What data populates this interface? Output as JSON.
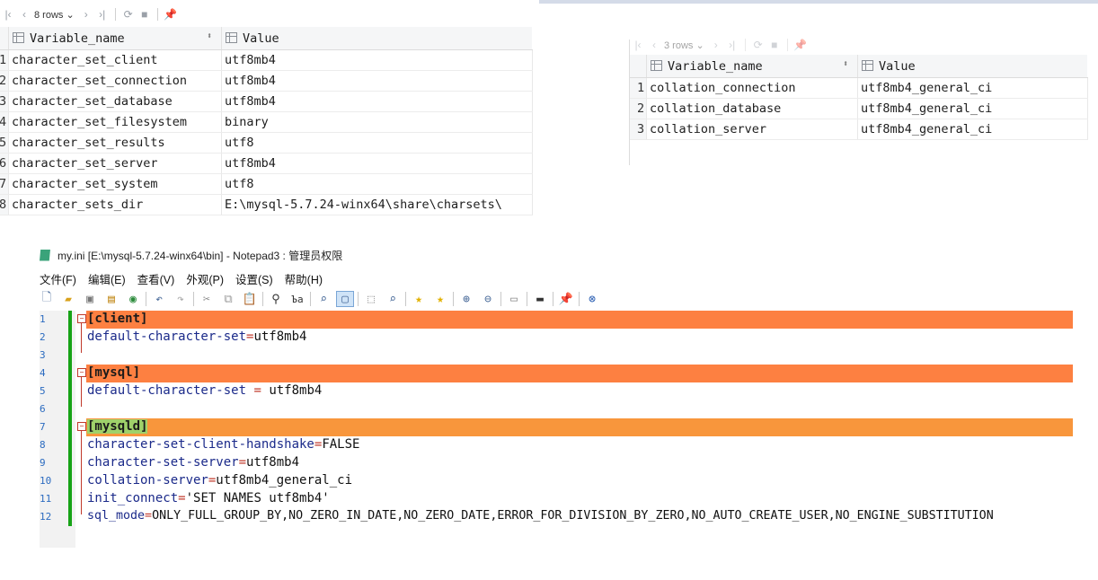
{
  "grid1": {
    "rows_label": "8 rows",
    "columns": [
      "Variable_name",
      "Value"
    ],
    "rows": [
      {
        "n": "1",
        "name": "character_set_client",
        "value": "utf8mb4"
      },
      {
        "n": "2",
        "name": "character_set_connection",
        "value": "utf8mb4"
      },
      {
        "n": "3",
        "name": "character_set_database",
        "value": "utf8mb4"
      },
      {
        "n": "4",
        "name": "character_set_filesystem",
        "value": "binary"
      },
      {
        "n": "5",
        "name": "character_set_results",
        "value": "utf8"
      },
      {
        "n": "6",
        "name": "character_set_server",
        "value": "utf8mb4"
      },
      {
        "n": "7",
        "name": "character_set_system",
        "value": "utf8"
      },
      {
        "n": "8",
        "name": "character_sets_dir",
        "value": "E:\\mysql-5.7.24-winx64\\share\\charsets\\"
      }
    ]
  },
  "grid2": {
    "rows_label": "3 rows",
    "columns": [
      "Variable_name",
      "Value"
    ],
    "rows": [
      {
        "n": "1",
        "name": "collation_connection",
        "value": "utf8mb4_general_ci"
      },
      {
        "n": "2",
        "name": "collation_database",
        "value": "utf8mb4_general_ci"
      },
      {
        "n": "3",
        "name": "collation_server",
        "value": "utf8mb4_general_ci"
      }
    ]
  },
  "notepad": {
    "title": "my.ini [E:\\mysql-5.7.24-winx64\\bin] - Notepad3 : 管理员权限",
    "menu": [
      "文件(F)",
      "编辑(E)",
      "查看(V)",
      "外观(P)",
      "设置(S)",
      "帮助(H)"
    ],
    "lines": {
      "l1": "[client]",
      "l2_key": "default-character-set",
      "l2_op": "=",
      "l2_val": "utf8mb4",
      "l4": "[mysql]",
      "l5_key": "default-character-set",
      "l5_op": " = ",
      "l5_val": "utf8mb4",
      "l7": "[mysqld]",
      "l8_key": "character-set-client-handshake",
      "l8_op": "=",
      "l8_val": "FALSE",
      "l9_key": "character-set-server",
      "l9_op": "=",
      "l9_val": "utf8mb4",
      "l10_key": "collation-server",
      "l10_op": "=",
      "l10_val": "utf8mb4_general_ci",
      "l11_key": "init_connect",
      "l11_op": "=",
      "l11_val": "'SET NAMES utf8mb4'",
      "l12_key": "sql_mode",
      "l12_op": "=",
      "l12_val": "ONLY_FULL_GROUP_BY,NO_ZERO_IN_DATE,NO_ZERO_DATE,ERROR_FOR_DIVISION_BY_ZERO,NO_AUTO_CREATE_USER,NO_ENGINE_SUBSTITUTION"
    },
    "line_numbers": [
      "1",
      "2",
      "3",
      "4",
      "5",
      "6",
      "7",
      "8",
      "9",
      "10",
      "11",
      "12"
    ]
  },
  "colors": {
    "section_highlight": "#fd8041",
    "mysqld_tag": "#9fd16a",
    "change_bar": "#17a317"
  }
}
